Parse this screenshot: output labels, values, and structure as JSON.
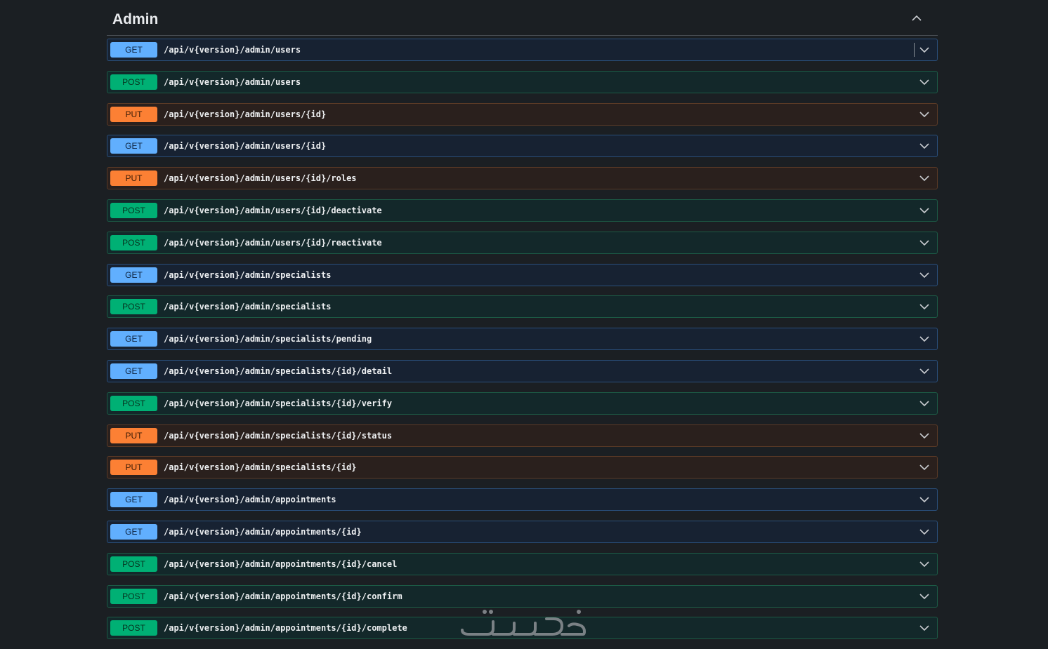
{
  "section": {
    "title": "Admin"
  },
  "operations": [
    {
      "method": "GET",
      "path": "/api/v{version}/admin/users"
    },
    {
      "method": "POST",
      "path": "/api/v{version}/admin/users"
    },
    {
      "method": "PUT",
      "path": "/api/v{version}/admin/users/{id}"
    },
    {
      "method": "GET",
      "path": "/api/v{version}/admin/users/{id}"
    },
    {
      "method": "PUT",
      "path": "/api/v{version}/admin/users/{id}/roles"
    },
    {
      "method": "POST",
      "path": "/api/v{version}/admin/users/{id}/deactivate"
    },
    {
      "method": "POST",
      "path": "/api/v{version}/admin/users/{id}/reactivate"
    },
    {
      "method": "GET",
      "path": "/api/v{version}/admin/specialists"
    },
    {
      "method": "POST",
      "path": "/api/v{version}/admin/specialists"
    },
    {
      "method": "GET",
      "path": "/api/v{version}/admin/specialists/pending"
    },
    {
      "method": "GET",
      "path": "/api/v{version}/admin/specialists/{id}/detail"
    },
    {
      "method": "POST",
      "path": "/api/v{version}/admin/specialists/{id}/verify"
    },
    {
      "method": "PUT",
      "path": "/api/v{version}/admin/specialists/{id}/status"
    },
    {
      "method": "PUT",
      "path": "/api/v{version}/admin/specialists/{id}"
    },
    {
      "method": "GET",
      "path": "/api/v{version}/admin/appointments"
    },
    {
      "method": "GET",
      "path": "/api/v{version}/admin/appointments/{id}"
    },
    {
      "method": "POST",
      "path": "/api/v{version}/admin/appointments/{id}/cancel"
    },
    {
      "method": "POST",
      "path": "/api/v{version}/admin/appointments/{id}/confirm"
    },
    {
      "method": "POST",
      "path": "/api/v{version}/admin/appointments/{id}/complete"
    }
  ],
  "colors": {
    "get": "#61affe",
    "post": "#00b074",
    "put": "#fc8034",
    "background": "#1b1f23"
  },
  "icons": {
    "section_toggle": "chevron-up-icon",
    "row_toggle": "chevron-down-icon",
    "watermark": "khamsat-logo"
  }
}
